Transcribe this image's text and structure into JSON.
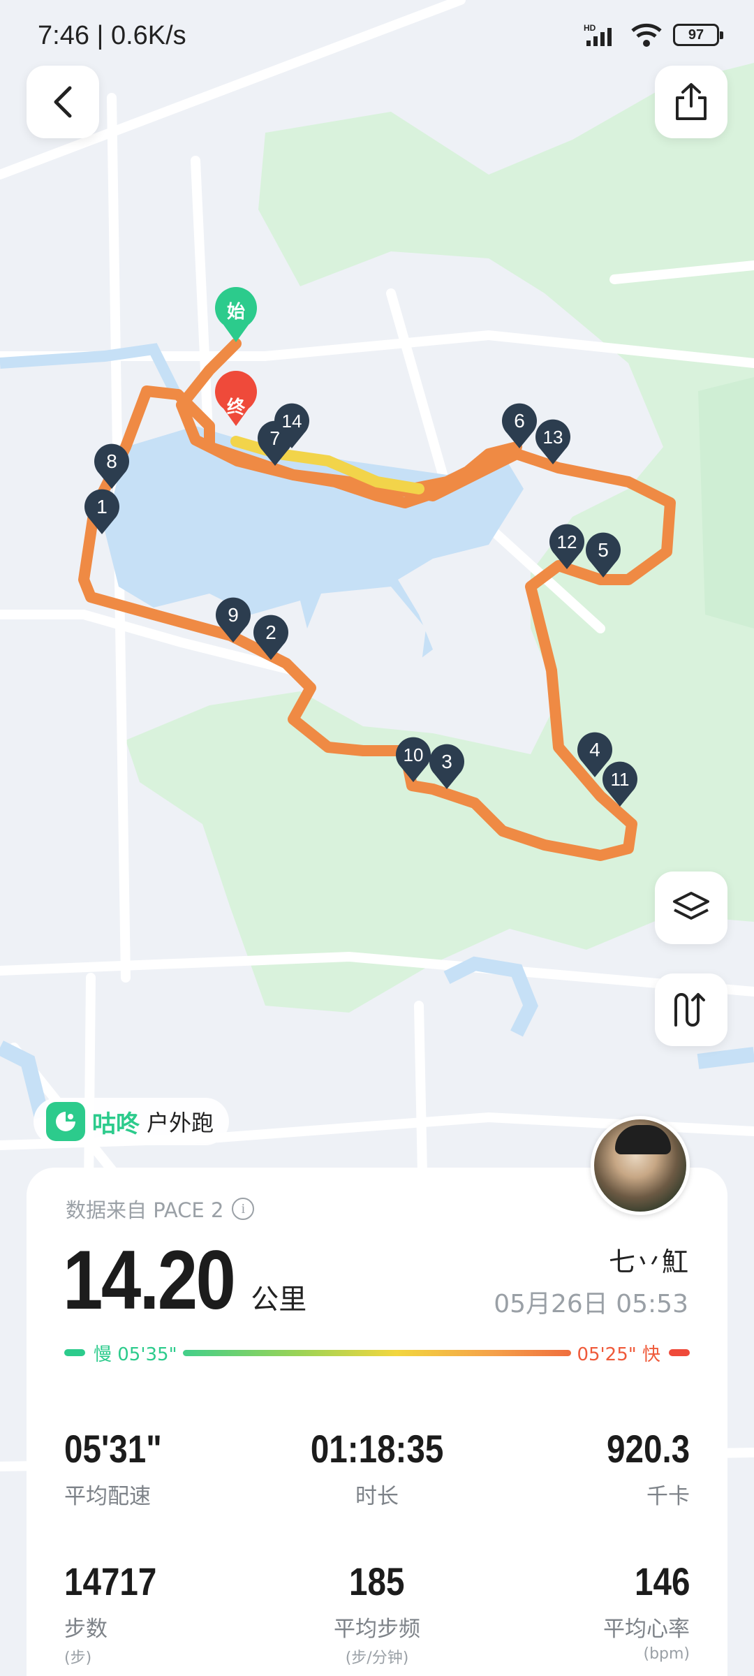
{
  "status_bar": {
    "time": "7:46 | 0.6K/s",
    "network_label": "HD",
    "battery": "97"
  },
  "map": {
    "start_label": "始",
    "end_label": "终",
    "km_markers": [
      "1",
      "2",
      "3",
      "4",
      "5",
      "6",
      "7",
      "8",
      "9",
      "10",
      "11",
      "12",
      "13",
      "14"
    ],
    "colors": {
      "route": "#ef8a44",
      "route_end": "#f2d44a",
      "marker": "#2c3d4f",
      "start": "#2ccb8c",
      "end": "#ef4a3a",
      "water": "#c6e0f6",
      "park": "#d9f2dc"
    }
  },
  "brand": {
    "name": "咕咚",
    "activity": "户外跑",
    "icon": "codoon-logo-icon"
  },
  "summary": {
    "source": "数据来自 PACE 2",
    "distance": "14.20",
    "distance_unit": "公里",
    "username": "七丷魟",
    "datetime": "05月26日 05:53",
    "pace_slow": "慢 05'35\"",
    "pace_fast": "05'25\" 快"
  },
  "stats": [
    {
      "value": "05'31\"",
      "label": "平均配速",
      "sub": ""
    },
    {
      "value": "01:18:35",
      "label": "时长",
      "sub": ""
    },
    {
      "value": "920.3",
      "label": "千卡",
      "sub": ""
    },
    {
      "value": "14717",
      "label": "步数",
      "sub": "(步)"
    },
    {
      "value": "185",
      "label": "平均步频",
      "sub": "(步/分钟)"
    },
    {
      "value": "146",
      "label": "平均心率",
      "sub": "(bpm)"
    }
  ]
}
